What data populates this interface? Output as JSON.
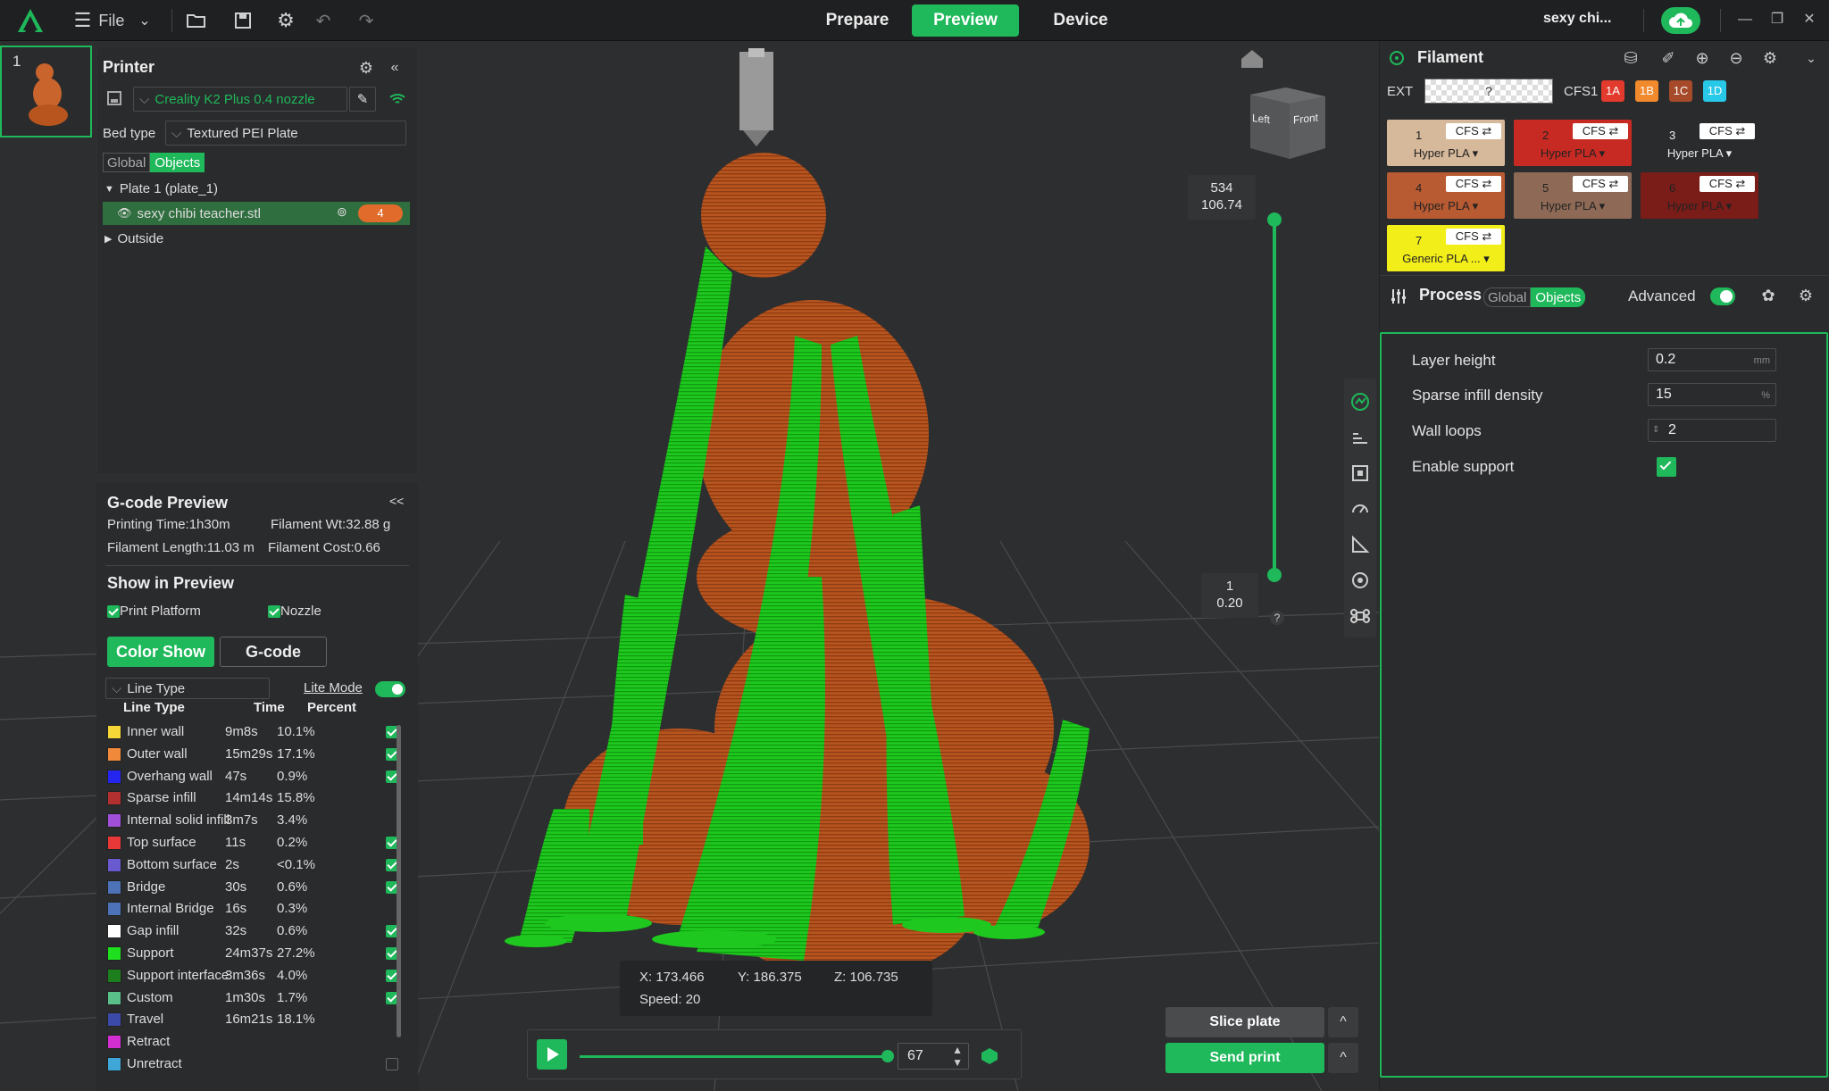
{
  "topbar": {
    "file_label": "File",
    "tabs": [
      "Prepare",
      "Preview",
      "Device"
    ],
    "active_tab": "Preview",
    "project_name": "sexy chi...",
    "accent": "#1fb85a"
  },
  "plate_thumb": {
    "number": "1"
  },
  "printer": {
    "title": "Printer",
    "printer_name": "Creality K2 Plus 0.4 nozzle",
    "bed_type_label": "Bed type",
    "bed_type_value": "Textured PEI Plate",
    "scope_global": "Global",
    "scope_objects": "Objects",
    "plate_label": "Plate 1 (plate_1)",
    "object_name": "sexy chibi teacher.stl",
    "object_badge": "4",
    "outside_label": "Outside"
  },
  "gcode": {
    "title": "G-code Preview",
    "collapse": "<<",
    "printing_time": "Printing Time:1h30m",
    "filament_wt": "Filament Wt:32.88 g",
    "filament_length": "Filament Length:11.03 m",
    "filament_cost": "Filament Cost:0.66",
    "show_title": "Show in Preview",
    "print_platform": "Print Platform",
    "nozzle": "Nozzle",
    "color_show": "Color Show",
    "gcode_btn": "G-code",
    "view_type": "Line Type",
    "lite_mode": "Lite Mode",
    "headers": {
      "type": "Line Type",
      "time": "Time",
      "percent": "Percent"
    },
    "rows": [
      {
        "name": "Inner wall",
        "time": "9m8s",
        "percent": "10.1%",
        "color": "#f5d738",
        "checked": true
      },
      {
        "name": "Outer wall",
        "time": "15m29s",
        "percent": "17.1%",
        "color": "#f08a3a",
        "checked": true
      },
      {
        "name": "Overhang wall",
        "time": "47s",
        "percent": "0.9%",
        "color": "#2525f0",
        "checked": true
      },
      {
        "name": "Sparse infill",
        "time": "14m14s",
        "percent": "15.8%",
        "color": "#b33030",
        "checked": false
      },
      {
        "name": "Internal solid infill",
        "time": "3m7s",
        "percent": "3.4%",
        "color": "#a050d8",
        "checked": false
      },
      {
        "name": "Top surface",
        "time": "11s",
        "percent": "0.2%",
        "color": "#e83838",
        "checked": true
      },
      {
        "name": "Bottom surface",
        "time": "2s",
        "percent": "<0.1%",
        "color": "#6a5ad0",
        "checked": true
      },
      {
        "name": "Bridge",
        "time": "30s",
        "percent": "0.6%",
        "color": "#4d72b8",
        "checked": true
      },
      {
        "name": "Internal Bridge",
        "time": "16s",
        "percent": "0.3%",
        "color": "#4d72b8",
        "checked": false
      },
      {
        "name": "Gap infill",
        "time": "32s",
        "percent": "0.6%",
        "color": "#ffffff",
        "checked": true
      },
      {
        "name": "Support",
        "time": "24m37s",
        "percent": "27.2%",
        "color": "#1ee01e",
        "checked": true
      },
      {
        "name": "Support interface",
        "time": "3m36s",
        "percent": "4.0%",
        "color": "#1c7e1c",
        "checked": true
      },
      {
        "name": "Custom",
        "time": "1m30s",
        "percent": "1.7%",
        "color": "#5ac08a",
        "checked": true
      },
      {
        "name": "Travel",
        "time": "16m21s",
        "percent": "18.1%",
        "color": "#3b4aa8",
        "checked": false
      },
      {
        "name": "Retract",
        "time": "",
        "percent": "",
        "color": "#d22ed2",
        "checked": false
      },
      {
        "name": "Unretract",
        "time": "",
        "percent": "",
        "color": "#3fa6d8",
        "checked": false
      }
    ]
  },
  "filament": {
    "title": "Filament",
    "ext_label": "EXT",
    "ext_value": "?",
    "cfs_label": "CFS1",
    "cfs_tags": [
      {
        "label": "1A",
        "color": "#e23a2c"
      },
      {
        "label": "1B",
        "color": "#f08a2c"
      },
      {
        "label": "1C",
        "color": "#a64a2a"
      },
      {
        "label": "1D",
        "color": "#28c8e8"
      }
    ],
    "slots": [
      {
        "idx": "1",
        "cfs": "CFS ⇄",
        "mat": "Hyper PLA ▾",
        "color": "#d6b89a",
        "text": "#222"
      },
      {
        "idx": "2",
        "cfs": "CFS ⇄",
        "mat": "Hyper PLA ▾",
        "color": "#c72a22",
        "text": "#222"
      },
      {
        "idx": "3",
        "cfs": "CFS ⇄",
        "mat": "Hyper PLA ▾",
        "color": "#2a2b2d",
        "text": "#eee"
      },
      {
        "idx": "4",
        "cfs": "CFS ⇄",
        "mat": "Hyper PLA ▾",
        "color": "#b85a32",
        "text": "#222"
      },
      {
        "idx": "5",
        "cfs": "CFS ⇄",
        "mat": "Hyper PLA ▾",
        "color": "#8e6a56",
        "text": "#222"
      },
      {
        "idx": "6",
        "cfs": "CFS ⇄",
        "mat": "Hyper PLA ▾",
        "color": "#7a1c18",
        "text": "#222"
      },
      {
        "idx": "7",
        "cfs": "CFS ⇄",
        "mat": "Generic PLA ... ▾",
        "color": "#f2ee1a",
        "text": "#222"
      }
    ]
  },
  "process": {
    "title": "Process",
    "scope_global": "Global",
    "scope_objects": "Objects",
    "advanced": "Advanced",
    "params": [
      {
        "label": "Layer height",
        "value": "0.2",
        "unit": "mm"
      },
      {
        "label": "Sparse infill density",
        "value": "15",
        "unit": "%"
      },
      {
        "label": "Wall loops",
        "value": "2",
        "unit": ""
      }
    ],
    "support_label": "Enable support",
    "support_enabled": true
  },
  "viewport": {
    "cube_left": "Left",
    "cube_front": "Front",
    "layer_top": "534",
    "layer_top_z": "106.74",
    "layer_bottom": "1",
    "layer_bottom_z": "0.20",
    "help": "?",
    "coord_x": "X: 173.466",
    "coord_y": "Y: 186.375",
    "coord_z": "Z: 106.735",
    "speed": "Speed: 20",
    "frame_value": "67",
    "slice_plate": "Slice plate",
    "send_print": "Send print",
    "caret": "^"
  }
}
